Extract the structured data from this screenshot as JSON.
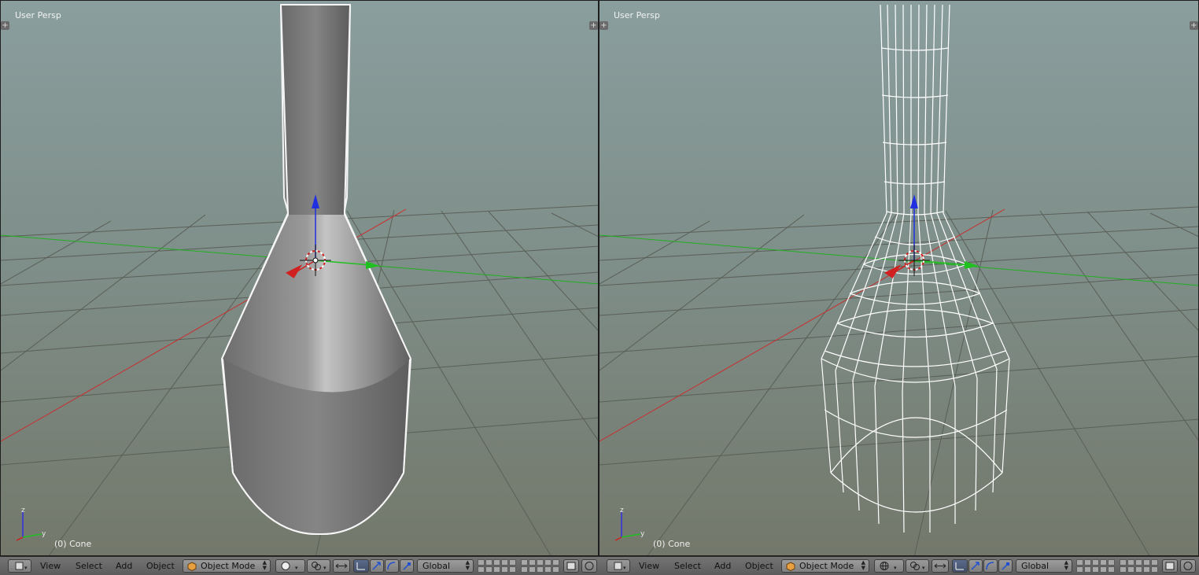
{
  "viewports": [
    {
      "title": "User Persp",
      "object_label": "(0) Cone",
      "shading": "solid"
    },
    {
      "title": "User Persp",
      "object_label": "(0) Cone",
      "shading": "wireframe"
    }
  ],
  "header": {
    "menus": [
      "View",
      "Select",
      "Add",
      "Object"
    ],
    "mode": "Object Mode",
    "orientation": "Global"
  },
  "axis_labels": {
    "z": "z",
    "y": "y"
  },
  "colors": {
    "x_axis": "#d02020",
    "y_axis": "#20c020",
    "z_axis": "#2020e0",
    "background_top": "#8a9e9e",
    "background_bottom": "#73786b"
  }
}
